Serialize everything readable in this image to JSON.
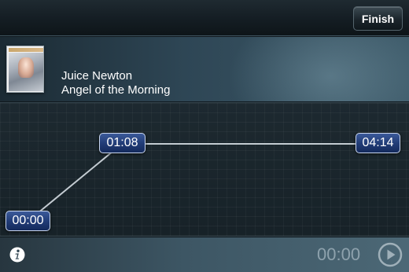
{
  "toolbar": {
    "finish_label": "Finish"
  },
  "now_playing": {
    "artist": "Juice Newton",
    "song": "Angel of the Morning",
    "album_art": "album-cover-image"
  },
  "timeline": {
    "start_label": "00:00",
    "marker_label": "01:08",
    "end_label": "04:14",
    "accent_color": "#223d78"
  },
  "player": {
    "elapsed": "00:00",
    "info_icon": "info-icon",
    "play_icon": "play-circle-icon"
  }
}
